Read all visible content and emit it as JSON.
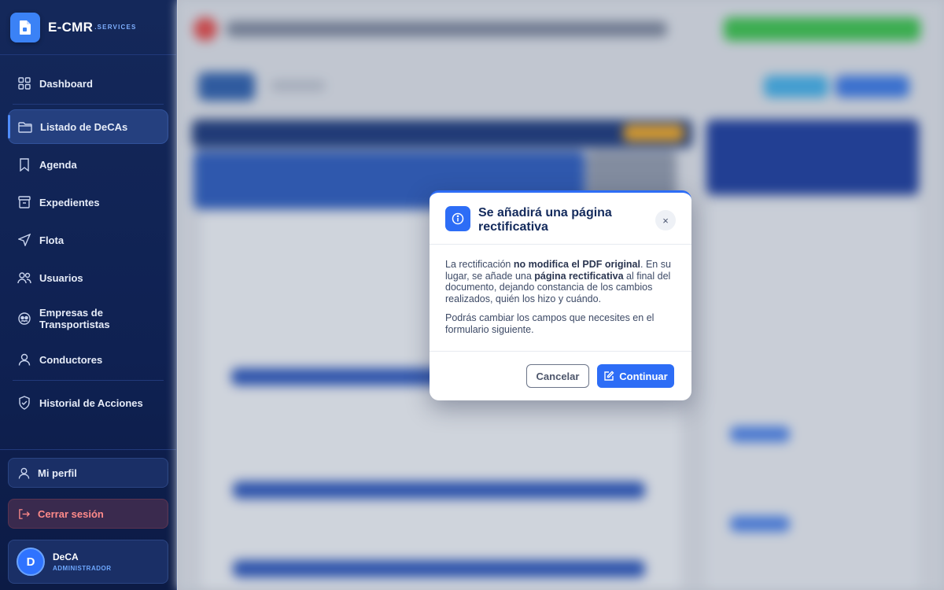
{
  "brand": {
    "name": "E-CMR",
    "suffix": ".SERVICES"
  },
  "sidebar": {
    "items": [
      {
        "label": "Dashboard",
        "icon": "grid-icon"
      },
      {
        "label": "Listado de DeCAs",
        "icon": "folder-icon",
        "active": true
      },
      {
        "label": "Agenda",
        "icon": "bookmark-icon"
      },
      {
        "label": "Expedientes",
        "icon": "archive-icon"
      },
      {
        "label": "Flota",
        "icon": "navigation-icon"
      },
      {
        "label": "Usuarios",
        "icon": "users-icon"
      },
      {
        "label": "Empresas de Transportistas",
        "icon": "companies-icon"
      },
      {
        "label": "Conductores",
        "icon": "user-icon"
      },
      {
        "label": "Historial de Acciones",
        "icon": "shield-icon"
      }
    ],
    "profile_label": "Mi perfil",
    "logout_label": "Cerrar sesión",
    "user": {
      "initial": "D",
      "name": "DeCA",
      "role": "ADMINISTRADOR"
    }
  },
  "modal": {
    "title": "Se añadirá una página rectificativa",
    "body_p1_a": "La rectificación ",
    "body_p1_b": "no modifica el PDF original",
    "body_p1_c": ". En su lugar, se añade una ",
    "body_p1_d": "página rectificativa",
    "body_p1_e": " al final del documento, dejando constancia de los cambios realizados, quién los hizo y cuándo.",
    "body_p2": "Podrás cambiar los campos que necesites en el formulario siguiente.",
    "cancel_label": "Cancelar",
    "continue_label": "Continuar",
    "close_symbol": "×"
  },
  "colors": {
    "accent": "#2d6df6",
    "sidebar_bg": "#14285a",
    "logout": "#ff8a8a"
  }
}
